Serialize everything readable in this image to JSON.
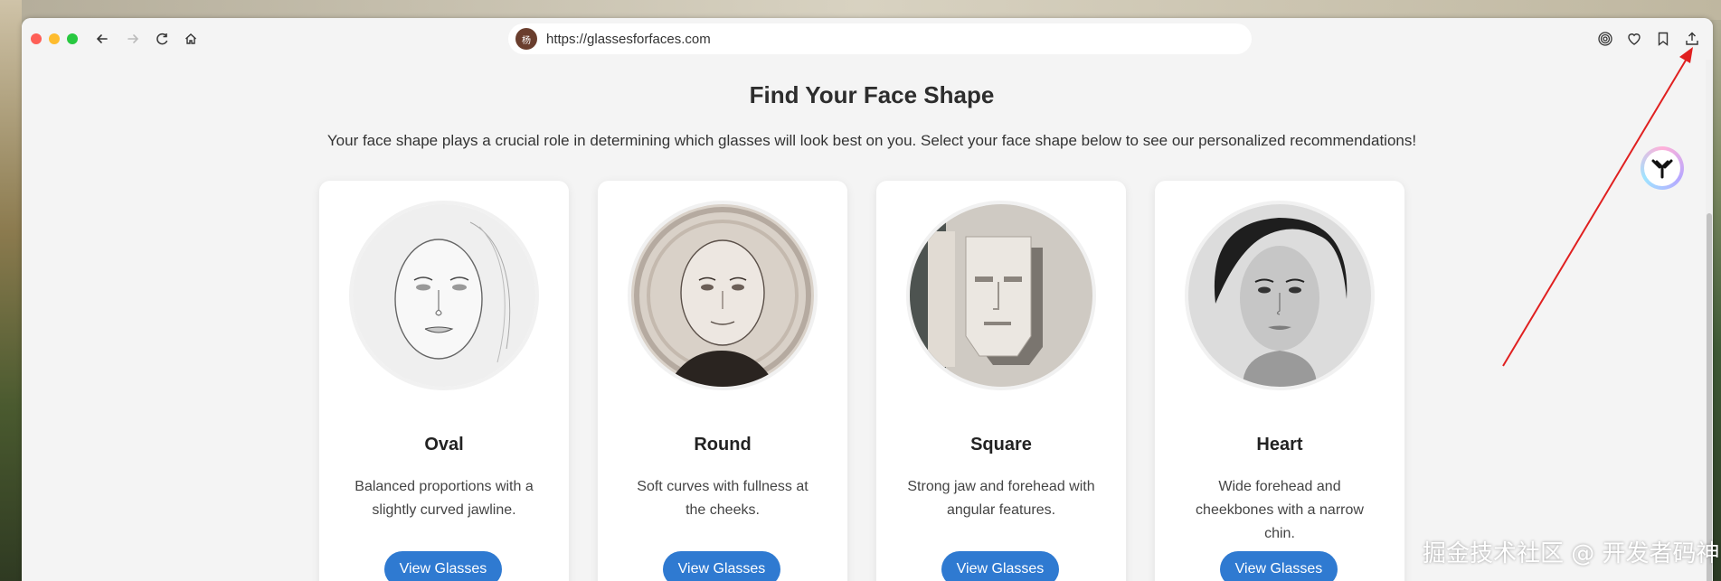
{
  "browser": {
    "url": "https://glassesforfaces.com",
    "site_badge": "杨",
    "nav": {
      "back_icon": "arrow-left-icon",
      "forward_icon": "arrow-right-icon",
      "reload_icon": "reload-icon",
      "home_icon": "home-icon"
    },
    "tools": [
      "target-icon",
      "heart-icon",
      "bookmark-icon",
      "share-icon"
    ]
  },
  "page": {
    "title": "Find Your Face Shape",
    "intro": "Your face shape plays a crucial role in determining which glasses will look best on you. Select your face shape below to see our personalized recommendations!",
    "cards": [
      {
        "title": "Oval",
        "desc": "Balanced proportions with a slightly curved jawline.",
        "button": "View Glasses"
      },
      {
        "title": "Round",
        "desc": "Soft curves with fullness at the cheeks.",
        "button": "View Glasses"
      },
      {
        "title": "Square",
        "desc": "Strong jaw and forehead with angular features.",
        "button": "View Glasses"
      },
      {
        "title": "Heart",
        "desc": "Wide forehead and cheekbones with a narrow chin.",
        "button": "View Glasses"
      }
    ]
  },
  "watermark": "掘金技术社区 @ 开发者码神",
  "colors": {
    "accent": "#2f7ad1",
    "annotation_arrow": "#e02020"
  }
}
